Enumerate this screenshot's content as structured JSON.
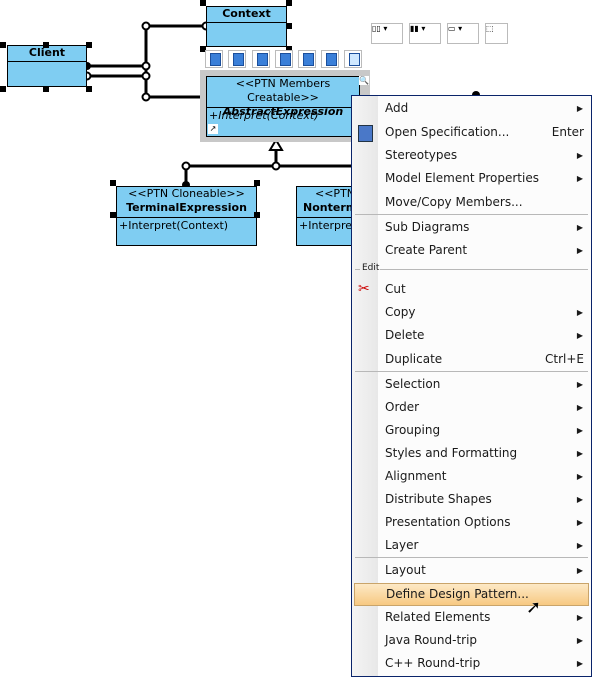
{
  "diagram": {
    "client": {
      "name": "Client"
    },
    "context": {
      "name": "Context"
    },
    "abstract": {
      "stereotype": "<<PTN Members Creatable>>",
      "name": "AbstractExpression",
      "operation": "+Interpret(Context)"
    },
    "terminal": {
      "stereotype": "<<PTN Cloneable>>",
      "name": "TerminalExpression",
      "operation": "+Interpret(Context)"
    },
    "nonterminal": {
      "stereotype": "<<PTN",
      "name": "Nontermi",
      "operation": "+Interpret("
    },
    "fill_color": "#7fcdf2"
  },
  "menu": {
    "items": [
      {
        "label": "Add",
        "submenu": true
      },
      {
        "label": "Open Specification...",
        "shortcut": "Enter",
        "icon": "specification-icon"
      },
      {
        "label": "Stereotypes",
        "submenu": true
      },
      {
        "label": "Model Element Properties",
        "submenu": true
      },
      {
        "label": "Move/Copy Members..."
      },
      {
        "label": "Sub Diagrams",
        "submenu": true
      },
      {
        "label": "Create Parent",
        "submenu": true
      },
      {
        "label": "Cut",
        "icon": "scissors-icon"
      },
      {
        "label": "Copy",
        "submenu": true
      },
      {
        "label": "Delete",
        "submenu": true
      },
      {
        "label": "Duplicate",
        "shortcut": "Ctrl+E"
      },
      {
        "label": "Selection",
        "submenu": true
      },
      {
        "label": "Order",
        "submenu": true
      },
      {
        "label": "Grouping",
        "submenu": true
      },
      {
        "label": "Styles and Formatting",
        "submenu": true
      },
      {
        "label": "Alignment",
        "submenu": true
      },
      {
        "label": "Distribute Shapes",
        "submenu": true
      },
      {
        "label": "Presentation Options",
        "submenu": true
      },
      {
        "label": "Layer",
        "submenu": true
      },
      {
        "label": "Layout",
        "submenu": true
      },
      {
        "label": "Define Design Pattern...",
        "highlighted": true
      },
      {
        "label": "Related Elements",
        "submenu": true
      },
      {
        "label": "Java Round-trip",
        "submenu": true
      },
      {
        "label": "C++ Round-trip",
        "submenu": true
      }
    ],
    "group_label": "Edit",
    "highlight_color": "#f7c982"
  }
}
